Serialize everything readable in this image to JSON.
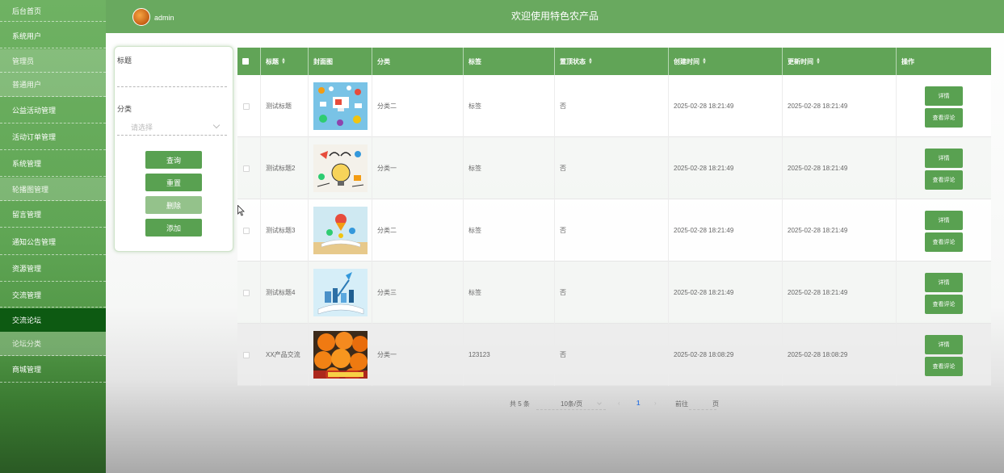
{
  "sidebar": {
    "items": [
      {
        "label": "后台首页"
      },
      {
        "label": "系统用户"
      },
      {
        "label": "管理员"
      },
      {
        "label": "普通用户"
      },
      {
        "label": "公益活动管理"
      },
      {
        "label": "活动订单管理"
      },
      {
        "label": "系统管理"
      },
      {
        "label": "轮播图管理"
      },
      {
        "label": "留言管理"
      },
      {
        "label": "通知公告管理"
      },
      {
        "label": "资源管理"
      },
      {
        "label": "交流管理"
      },
      {
        "label": "交流论坛"
      },
      {
        "label": "论坛分类"
      },
      {
        "label": "商城管理"
      }
    ]
  },
  "header": {
    "username": "admin",
    "title": "欢迎使用特色农产品"
  },
  "search": {
    "title_label": "标题",
    "title_value": "",
    "category_label": "分类",
    "category_placeholder": "请选择",
    "query_button": "查询",
    "reset_button": "重置",
    "delete_button": "删除",
    "add_button": "添加"
  },
  "table": {
    "columns": [
      "标题",
      "封面图",
      "分类",
      "标签",
      "置顶状态",
      "创建时间",
      "更新时间",
      "操作"
    ],
    "rows": [
      {
        "title": "测试标题",
        "category": "分类二",
        "tag": "标签",
        "pinned": "否",
        "created": "2025-02-28 18:21:49",
        "updated": "2025-02-28 18:21:49",
        "detail": "详情",
        "comments": "查看评论"
      },
      {
        "title": "测试标题2",
        "category": "分类一",
        "tag": "标签",
        "pinned": "否",
        "created": "2025-02-28 18:21:49",
        "updated": "2025-02-28 18:21:49",
        "detail": "详情",
        "comments": "查看评论"
      },
      {
        "title": "测试标题3",
        "category": "分类二",
        "tag": "标签",
        "pinned": "否",
        "created": "2025-02-28 18:21:49",
        "updated": "2025-02-28 18:21:49",
        "detail": "详情",
        "comments": "查看评论"
      },
      {
        "title": "测试标题4",
        "category": "分类三",
        "tag": "标签",
        "pinned": "否",
        "created": "2025-02-28 18:21:49",
        "updated": "2025-02-28 18:21:49",
        "detail": "详情",
        "comments": "查看评论"
      },
      {
        "title": "XX产品交流",
        "category": "分类一",
        "tag": "123123",
        "pinned": "否",
        "created": "2025-02-28 18:08:29",
        "updated": "2025-02-28 18:08:29",
        "detail": "详情",
        "comments": "查看评论"
      }
    ]
  },
  "pagination": {
    "total": "共 5 条",
    "page_size": "10条/页",
    "current_page": "1",
    "goto_label": "前往",
    "page_unit": "页"
  },
  "colors": {
    "primary": "#61a457",
    "sidebar_active": "#0d5a12",
    "header": "#69a95f"
  }
}
